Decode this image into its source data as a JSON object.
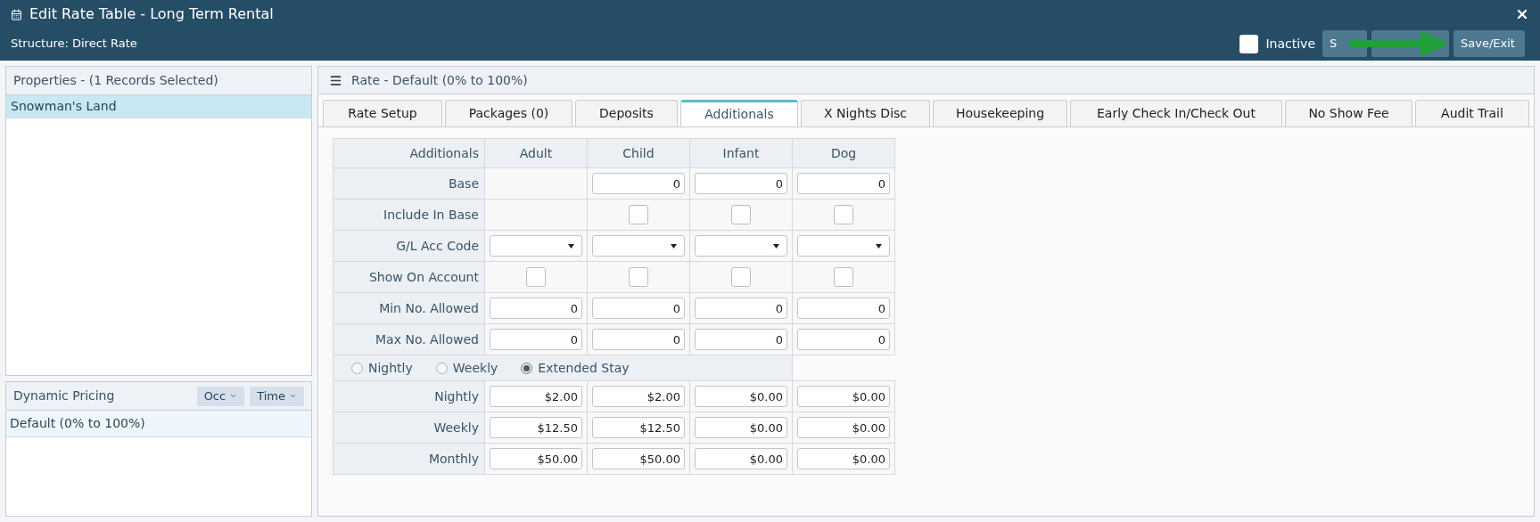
{
  "window": {
    "title": "Edit Rate Table - Long Term Rental",
    "subtitle": "Structure: Direct Rate",
    "inactive": {
      "label": "Inactive",
      "checked": false
    },
    "buttons": [
      {
        "label": "S"
      },
      {
        "kind": "covered"
      },
      {
        "label": "Save/Exit"
      }
    ]
  },
  "properties": {
    "title": "Properties - (1 Records Selected)",
    "items": [
      {
        "label": "Snowman's Land",
        "selected": true
      }
    ]
  },
  "dynamic_pricing": {
    "title": "Dynamic Pricing",
    "filters": [
      "Occ",
      "Time"
    ],
    "items": [
      {
        "label": "Default (0% to 100%)",
        "selected": true
      }
    ]
  },
  "rate_panel": {
    "title": "Rate - Default (0% to 100%)",
    "tabs": [
      {
        "label": "Rate Setup",
        "selected": false
      },
      {
        "label": "Packages (0)",
        "selected": false
      },
      {
        "label": "Deposits",
        "selected": false
      },
      {
        "label": "Additionals",
        "selected": true
      },
      {
        "label": "X Nights Disc",
        "selected": false
      },
      {
        "label": "Housekeeping",
        "selected": false
      },
      {
        "label": "Early Check In/Check Out",
        "selected": false
      },
      {
        "label": "No Show Fee",
        "selected": false
      },
      {
        "label": "Audit Trail",
        "selected": false
      }
    ],
    "table": {
      "row_header": "Additionals",
      "columns": [
        "Adult",
        "Child",
        "Infant",
        "Dog"
      ],
      "rows": [
        {
          "label": "Base",
          "cells": [
            {
              "kind": "blank"
            },
            {
              "kind": "input",
              "value": "0"
            },
            {
              "kind": "input",
              "value": "0"
            },
            {
              "kind": "input",
              "value": "0"
            }
          ]
        },
        {
          "label": "Include In Base",
          "cells": [
            {
              "kind": "blank"
            },
            {
              "kind": "checkbox",
              "checked": false
            },
            {
              "kind": "checkbox",
              "checked": false
            },
            {
              "kind": "checkbox",
              "checked": false
            }
          ]
        },
        {
          "label": "G/L Acc Code",
          "cells": [
            {
              "kind": "select"
            },
            {
              "kind": "select"
            },
            {
              "kind": "select"
            },
            {
              "kind": "select"
            }
          ]
        },
        {
          "label": "Show On Account",
          "cells": [
            {
              "kind": "checkbox",
              "checked": false
            },
            {
              "kind": "checkbox",
              "checked": false
            },
            {
              "kind": "checkbox",
              "checked": false
            },
            {
              "kind": "checkbox",
              "checked": false
            }
          ]
        },
        {
          "label": "Min No. Allowed",
          "cells": [
            {
              "kind": "input",
              "value": "0"
            },
            {
              "kind": "input",
              "value": "0"
            },
            {
              "kind": "input",
              "value": "0"
            },
            {
              "kind": "input",
              "value": "0"
            }
          ]
        },
        {
          "label": "Max No. Allowed",
          "cells": [
            {
              "kind": "input",
              "value": "0"
            },
            {
              "kind": "input",
              "value": "0"
            },
            {
              "kind": "input",
              "value": "0"
            },
            {
              "kind": "input",
              "value": "0"
            }
          ]
        }
      ],
      "rate_modes": [
        {
          "label": "Nightly",
          "selected": false
        },
        {
          "label": "Weekly",
          "selected": false
        },
        {
          "label": "Extended Stay",
          "selected": true
        }
      ],
      "rate_rows": [
        {
          "label": "Nightly",
          "cells": [
            {
              "kind": "input",
              "value": "$2.00"
            },
            {
              "kind": "input",
              "value": "$2.00"
            },
            {
              "kind": "input",
              "value": "$0.00"
            },
            {
              "kind": "input",
              "value": "$0.00"
            }
          ]
        },
        {
          "label": "Weekly",
          "cells": [
            {
              "kind": "input",
              "value": "$12.50"
            },
            {
              "kind": "input",
              "value": "$12.50"
            },
            {
              "kind": "input",
              "value": "$0.00"
            },
            {
              "kind": "input",
              "value": "$0.00"
            }
          ]
        },
        {
          "label": "Monthly",
          "cells": [
            {
              "kind": "input",
              "value": "$50.00"
            },
            {
              "kind": "input",
              "value": "$50.00"
            },
            {
              "kind": "input",
              "value": "$0.00"
            },
            {
              "kind": "input",
              "value": "$0.00"
            }
          ]
        }
      ]
    }
  }
}
